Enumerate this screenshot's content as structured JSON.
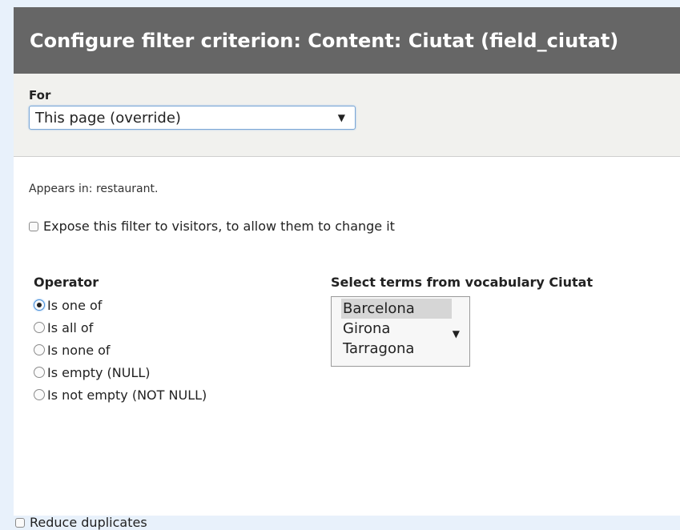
{
  "dialog": {
    "title": "Configure filter criterion: Content: Ciutat (field_ciutat)"
  },
  "for_section": {
    "label": "For",
    "select_value": "This page (override)"
  },
  "appears_in": "Appears in: restaurant.",
  "expose": {
    "label": "Expose this filter to visitors, to allow them to change it",
    "checked": false
  },
  "operator": {
    "label": "Operator",
    "options": [
      {
        "label": "Is one of",
        "checked": true
      },
      {
        "label": "Is all of",
        "checked": false
      },
      {
        "label": "Is none of",
        "checked": false
      },
      {
        "label": "Is empty (NULL)",
        "checked": false
      },
      {
        "label": "Is not empty (NOT NULL)",
        "checked": false
      }
    ]
  },
  "terms": {
    "label": "Select terms from vocabulary Ciutat",
    "options": [
      {
        "label": "Barcelona",
        "selected": true
      },
      {
        "label": "Girona",
        "selected": false
      },
      {
        "label": "Tarragona",
        "selected": false
      }
    ]
  },
  "reduce": {
    "label": "Reduce duplicates",
    "checked": false
  },
  "colors": {
    "page_background": "#e8f1fb",
    "titlebar": "#666666",
    "for_section_background": "#f1f1ee",
    "focus_border": "#7aa7d6"
  },
  "icons": {
    "dropdown": "triangle-down"
  }
}
